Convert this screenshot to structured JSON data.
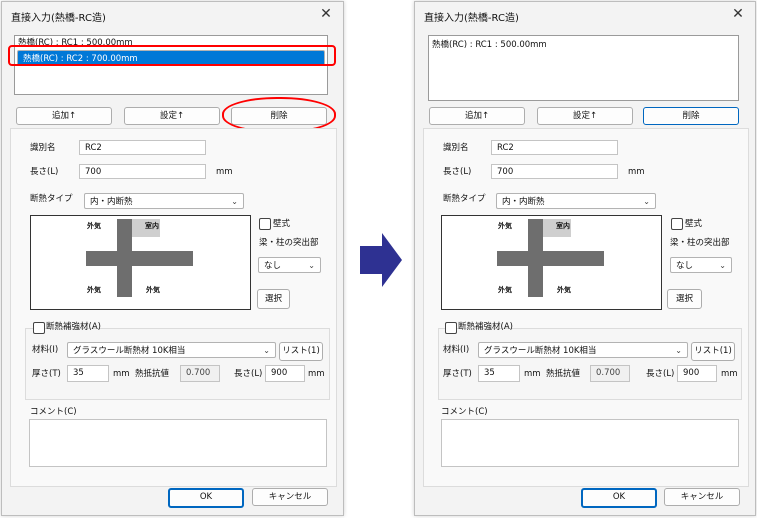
{
  "colors": {
    "accent": "#0078d7",
    "highlight": "#ff0000",
    "arrow": "#2e3192",
    "wall": "#6e6e6e",
    "room": "#cfcfcf"
  },
  "left": {
    "title": "直接入力(熱橋-RC造)",
    "list_items": [
      "熱橋(RC) : RC1 : 500.00mm",
      "熱橋(RC) : RC2 : 700.00mm"
    ],
    "buttons": {
      "add": "追加↑",
      "settings": "設定↑",
      "delete": "削除"
    },
    "form": {
      "name_label": "識別名",
      "name_value": "RC2",
      "length_label": "長さ(L)",
      "length_value": "700",
      "length_unit": "mm",
      "type_label": "断熱タイプ",
      "type_value": "内・内断熱",
      "diagram": {
        "tl": "外気",
        "tr": "室内",
        "bl": "外気",
        "br": "外気"
      },
      "wall_label": "壁式",
      "beam_label": "梁・柱の突出部",
      "beam_value": "なし",
      "select_button": "選択",
      "reinforce_label": "断熱補強材(A)",
      "material_label": "材料(I)",
      "material_value": "グラスウール断熱材 10K相当",
      "list_button": "リスト(1)",
      "thickness_label": "厚さ(T)",
      "thickness_value": "35",
      "thickness_unit": "mm",
      "resistance_label": "熱抵抗値",
      "resistance_value": "0.700",
      "len2_label": "長さ(L)",
      "len2_value": "900",
      "len2_unit": "mm",
      "comment_label": "コメント(C)"
    },
    "ok": "OK",
    "cancel": "キャンセル"
  },
  "right": {
    "title": "直接入力(熱橋-RC造)",
    "list_items": [
      "熱橋(RC) : RC1 : 500.00mm"
    ],
    "buttons": {
      "add": "追加↑",
      "settings": "設定↑",
      "delete": "削除"
    },
    "form": {
      "name_label": "識別名",
      "name_value": "RC2",
      "length_label": "長さ(L)",
      "length_value": "700",
      "length_unit": "mm",
      "type_label": "断熱タイプ",
      "type_value": "内・内断熱",
      "diagram": {
        "tl": "外気",
        "tr": "室内",
        "bl": "外気",
        "br": "外気"
      },
      "wall_label": "壁式",
      "beam_label": "梁・柱の突出部",
      "beam_value": "なし",
      "select_button": "選択",
      "reinforce_label": "断熱補強材(A)",
      "material_label": "材料(I)",
      "material_value": "グラスウール断熱材 10K相当",
      "list_button": "リスト(1)",
      "thickness_label": "厚さ(T)",
      "thickness_value": "35",
      "thickness_unit": "mm",
      "resistance_label": "熱抵抗値",
      "resistance_value": "0.700",
      "len2_label": "長さ(L)",
      "len2_value": "900",
      "len2_unit": "mm",
      "comment_label": "コメント(C)"
    },
    "ok": "OK",
    "cancel": "キャンセル"
  }
}
